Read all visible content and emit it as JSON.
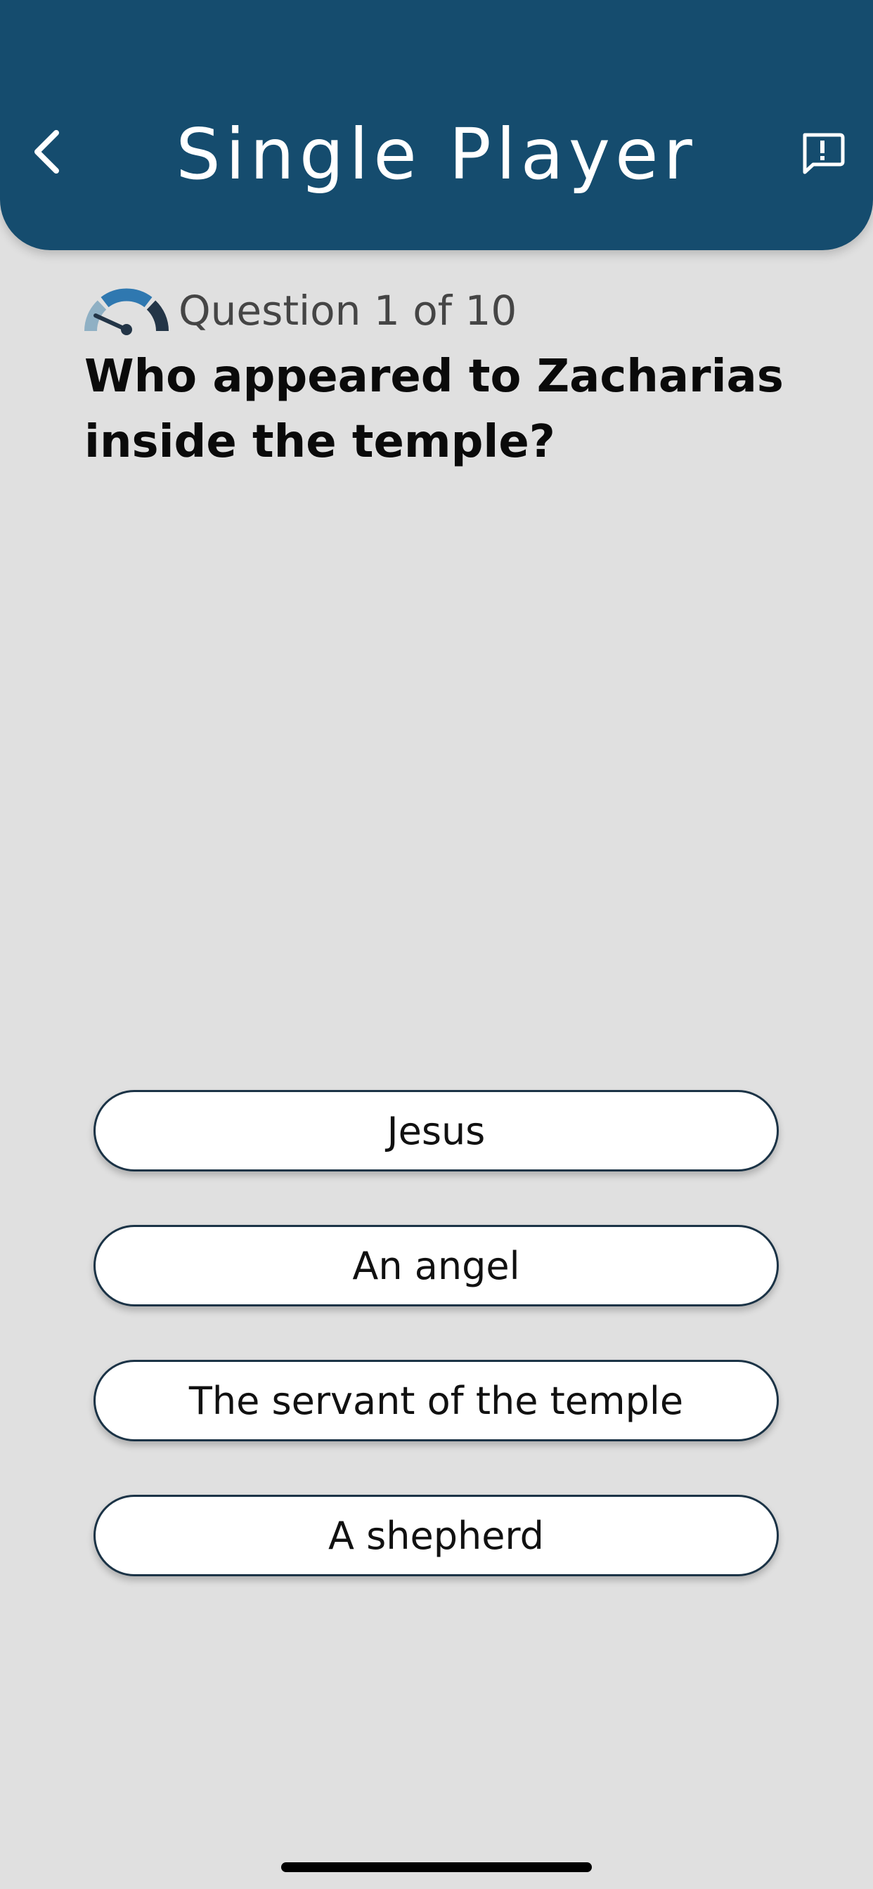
{
  "header": {
    "title": "Single Player",
    "back_icon": "chevron-left-icon",
    "report_icon": "feedback-icon",
    "background_color": "#154c6e"
  },
  "progress": {
    "label": "Question 1 of 10",
    "difficulty_icon": "gauge-icon"
  },
  "question": {
    "text": "Who appeared to Zacharias inside the temple?"
  },
  "answers": [
    {
      "label": "Jesus"
    },
    {
      "label": "An angel"
    },
    {
      "label": "The servant of the temple"
    },
    {
      "label": "A shepherd"
    }
  ],
  "colors": {
    "background": "#e0e0e0",
    "answer_border": "#1b3346",
    "gauge_light": "#8fb0c4",
    "gauge_mid": "#2f78b0",
    "gauge_dark": "#233547"
  }
}
